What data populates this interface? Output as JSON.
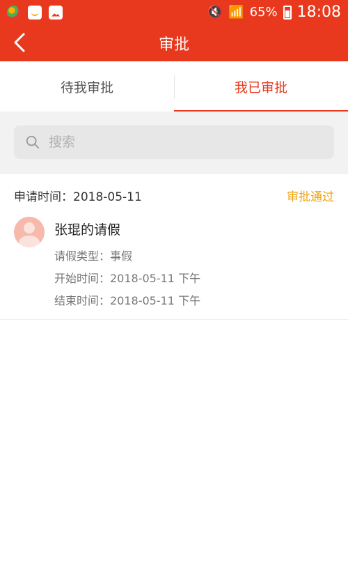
{
  "status_bar": {
    "battery": "65%",
    "time": "18:08"
  },
  "nav": {
    "title": "审批"
  },
  "tabs": [
    {
      "label": "待我审批",
      "active": false
    },
    {
      "label": "我已审批",
      "active": true
    }
  ],
  "search": {
    "placeholder": "搜索"
  },
  "records": [
    {
      "apply_time": "申请时间：2018-05-11",
      "status": "审批通过",
      "title": "张琨的请假",
      "type_line": "请假类型：事假",
      "start_line": "开始时间：2018-05-11  下午",
      "end_line": "结束时间：2018-05-11  下午"
    }
  ],
  "colors": {
    "accent": "#e8391e",
    "status_approved": "#f0a20a"
  }
}
